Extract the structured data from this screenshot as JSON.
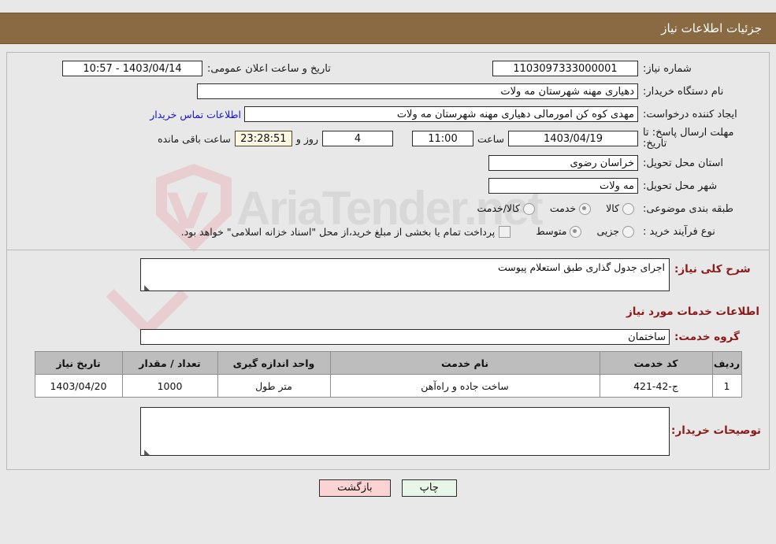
{
  "header": {
    "title": "جزئیات اطلاعات نیاز",
    "bg": "#8a6a42",
    "fg": "#ffffff"
  },
  "form": {
    "need_number_label": "شماره نیاز:",
    "need_number_value": "1103097333000001",
    "announce_label": "تاریخ و ساعت اعلان عمومی:",
    "announce_value": "1403/04/14 - 10:57",
    "buyer_org_label": "نام دستگاه خریدار:",
    "buyer_org_value": "دهیاری مهنه  شهرستان مه ولات",
    "creator_label": "ایجاد کننده درخواست:",
    "creator_value": "مهدی کوه کن امورمالی دهیاری مهنه  شهرستان مه ولات",
    "contact_link": "اطلاعات تماس خریدار",
    "deadline_label_1": "مهلت ارسال پاسخ: تا",
    "deadline_label_2": "تاریخ:",
    "deadline_date": "1403/04/19",
    "hour_label": "ساعت",
    "deadline_time": "11:00",
    "days_remaining": "4",
    "days_sep_label": "روز و",
    "time_remaining": "23:28:51",
    "remaining_suffix": "ساعت باقی مانده",
    "province_label": "استان محل تحویل:",
    "province_value": "خراسان رضوی",
    "city_label": "شهر محل تحویل:",
    "city_value": "مه ولات",
    "category_label": "طبقه بندی موضوعی:",
    "category_options": [
      {
        "label": "کالا",
        "selected": false
      },
      {
        "label": "خدمت",
        "selected": true
      },
      {
        "label": "کالا/خدمت",
        "selected": false
      }
    ],
    "process_label": "نوع فرآیند خرید :",
    "process_options": [
      {
        "label": "جزیی",
        "selected": false
      },
      {
        "label": "متوسط",
        "selected": true
      }
    ],
    "treasury_checkbox_label": "پرداخت تمام یا بخشی از مبلغ خرید،از محل \"اسناد خزانه اسلامی\" خواهد بود.",
    "treasury_checked": false
  },
  "details": {
    "general_desc_label": "شرح کلی نیاز:",
    "general_desc_value": "اجرای جدول گذاری طبق استعلام پیوست",
    "services_heading": "اطلاعات خدمات مورد نیاز",
    "service_group_label": "گروه خدمت:",
    "service_group_value": "ساختمان",
    "buyer_notes_label": "توصیحات خریدار:",
    "buyer_notes_value": "",
    "buyer_notes_placeholder": ""
  },
  "table": {
    "columns": [
      "ردیف",
      "کد خدمت",
      "نام خدمت",
      "واحد اندازه گیری",
      "تعداد / مقدار",
      "تاریخ نیاز"
    ],
    "rows": [
      {
        "index": "1",
        "service_code": "ج-42-421",
        "service_name": "ساخت جاده و راه‌آهن",
        "unit": "متر طول",
        "quantity": "1000",
        "need_date": "1403/04/20"
      }
    ]
  },
  "buttons": {
    "print": "چاپ",
    "back": "بازگشت"
  },
  "watermark": {
    "text": "AriaTender.net"
  }
}
